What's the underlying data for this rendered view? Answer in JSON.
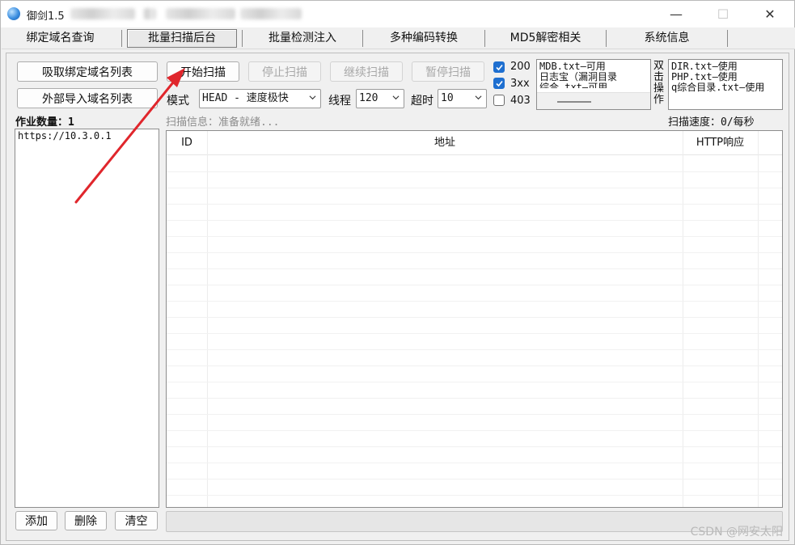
{
  "window": {
    "title": "御剑1.5",
    "controls": {
      "minimize": "—",
      "maximize": "☐",
      "close": "✕"
    }
  },
  "tabs": [
    {
      "label": "绑定域名查询"
    },
    {
      "label": "批量扫描后台"
    },
    {
      "label": "批量检测注入"
    },
    {
      "label": "多种编码转换"
    },
    {
      "label": "MD5解密相关"
    },
    {
      "label": "系统信息"
    }
  ],
  "active_tab": "批量扫描后台",
  "left_panel": {
    "fetch_domains_button": "吸取绑定域名列表",
    "import_domains_button": "外部导入域名列表",
    "job_count_label": "作业数量：1",
    "domains": [
      "https://10.3.0.1"
    ],
    "add_button": "添加",
    "delete_button": "删除",
    "clear_button": "清空"
  },
  "toolbar": {
    "start_button": "开始扫描",
    "stop_button": "停止扫描",
    "continue_button": "继续扫描",
    "pause_button": "暂停扫描",
    "mode_label": "模式",
    "mode_value": "HEAD - 速度极快",
    "threads_label": "线程",
    "threads_value": "120",
    "timeout_label": "超时",
    "timeout_value": "10"
  },
  "status_filters": [
    {
      "label": "200",
      "checked": true
    },
    {
      "label": "3xx",
      "checked": true
    },
    {
      "label": "403",
      "checked": false
    }
  ],
  "dictionaries_a": [
    "MDB.txt—可用",
    "日志宝（漏洞目录",
    "综合.txt—可用"
  ],
  "double_click_label": "双击操作",
  "dictionaries_b": [
    "DIR.txt—使用",
    "PHP.txt—使用",
    "q综合目录.txt—使用"
  ],
  "scan_info": {
    "label": "扫描信息：准备就绪...",
    "speed_label": "扫描速度：0/每秒"
  },
  "results_table": {
    "columns": [
      "ID",
      "地址",
      "HTTP响应"
    ],
    "rows": []
  },
  "watermark": "CSDN @网安太阳",
  "colors": {
    "checkbox_on": "#1e6fd0",
    "annotation_arrow": "#e0262c"
  }
}
